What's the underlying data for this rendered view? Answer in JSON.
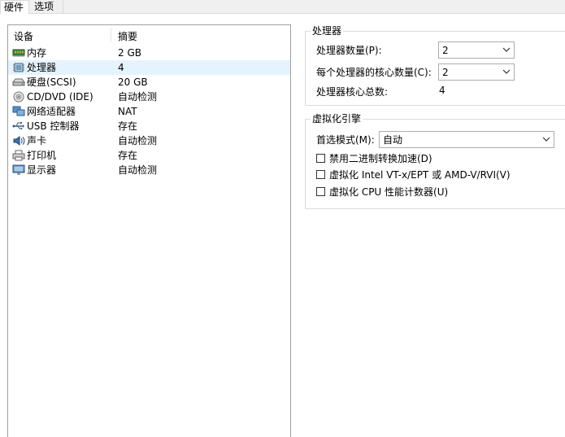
{
  "tabs": [
    {
      "label": "硬件",
      "active": true
    },
    {
      "label": "选项",
      "active": false
    }
  ],
  "device_list": {
    "columns": [
      "设备",
      "摘要"
    ],
    "rows": [
      {
        "icon": "memory-icon",
        "name": "内存",
        "summary": "2 GB",
        "selected": false
      },
      {
        "icon": "processor-icon",
        "name": "处理器",
        "summary": "4",
        "selected": true
      },
      {
        "icon": "hard-disk-icon",
        "name": "硬盘(SCSI)",
        "summary": "20 GB",
        "selected": false
      },
      {
        "icon": "cd-dvd-icon",
        "name": "CD/DVD (IDE)",
        "summary": "自动检测",
        "selected": false
      },
      {
        "icon": "network-adapter-icon",
        "name": "网络适配器",
        "summary": "NAT",
        "selected": false
      },
      {
        "icon": "usb-icon",
        "name": "USB 控制器",
        "summary": "存在",
        "selected": false
      },
      {
        "icon": "sound-card-icon",
        "name": "声卡",
        "summary": "自动检测",
        "selected": false
      },
      {
        "icon": "printer-icon",
        "name": "打印机",
        "summary": "存在",
        "selected": false
      },
      {
        "icon": "display-icon",
        "name": "显示器",
        "summary": "自动检测",
        "selected": false
      }
    ]
  },
  "processors": {
    "title": "处理器",
    "count_label": "处理器数量(P):",
    "count_value": "2",
    "cores_label": "每个处理器的核心数量(C):",
    "cores_value": "2",
    "total_label": "处理器核心总数:",
    "total_value": "4"
  },
  "virtualization": {
    "title": "虚拟化引擎",
    "mode_label": "首选模式(M):",
    "mode_value": "自动",
    "options": [
      {
        "label": "禁用二进制转换加速(D)",
        "checked": false
      },
      {
        "label": "虚拟化 Intel VT-x/EPT 或 AMD-V/RVI(V)",
        "checked": false
      },
      {
        "label": "虚拟化 CPU 性能计数器(U)",
        "checked": false
      }
    ]
  }
}
